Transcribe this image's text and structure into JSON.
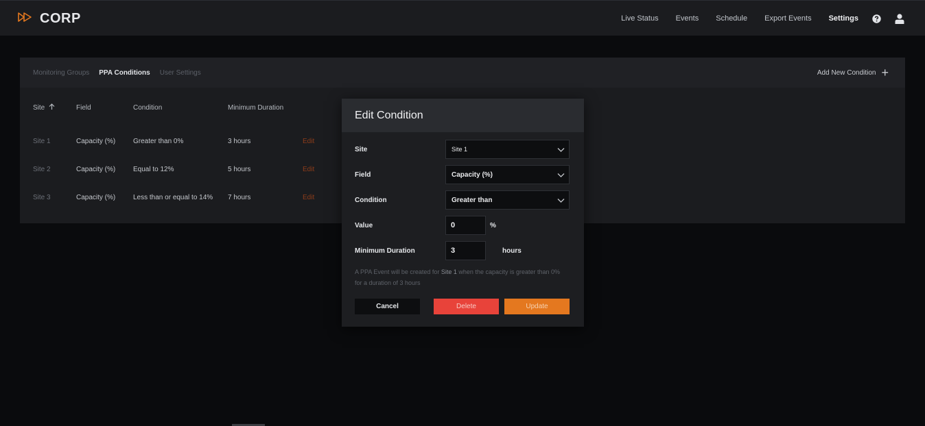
{
  "app": {
    "logo_text": "CORP",
    "accent": "#e4781f"
  },
  "nav": {
    "items": [
      "Live Status",
      "Events",
      "Schedule",
      "Export Events",
      "Settings"
    ],
    "active": "Settings",
    "help_icon": "help-circle-icon",
    "user_icon": "user-icon"
  },
  "settings": {
    "tabs": [
      "Monitoring Groups",
      "PPA Conditions",
      "User Settings"
    ],
    "active_tab": "PPA Conditions",
    "add_label": "Add New Condition",
    "columns": [
      "Site",
      "Field",
      "Condition",
      "Minimum Duration"
    ],
    "sort_column": "Site",
    "rows": [
      {
        "site": "Site 1",
        "field": "Capacity (%)",
        "condition": "Greater than 0%",
        "duration": "3 hours",
        "action": "Edit"
      },
      {
        "site": "Site 2",
        "field": "Capacity (%)",
        "condition": "Equal to 12%",
        "duration": "5 hours",
        "action": "Edit"
      },
      {
        "site": "Site 3",
        "field": "Capacity (%)",
        "condition": "Less than or equal to 14%",
        "duration": "7 hours",
        "action": "Edit"
      }
    ]
  },
  "modal": {
    "title": "Edit Condition",
    "site_label": "Site",
    "site_value": "Site 1",
    "field_label": "Field",
    "field_value": "Capacity (%)",
    "condition_label": "Condition",
    "condition_value": "Greater than",
    "value_label": "Value",
    "value": "0",
    "value_unit": "%",
    "duration_label": "Minimum Duration",
    "duration_value": "3",
    "duration_unit": "hours",
    "desc_pre": "A PPA Event will be created for ",
    "desc_site": "Site 1",
    "desc_post": " when the capacity is greater than 0% for a duration of 3 hours",
    "cancel_label": "Cancel",
    "delete_label": "Delete",
    "update_label": "Update",
    "delete_color": "#e8433a",
    "update_color": "#e4781f"
  }
}
